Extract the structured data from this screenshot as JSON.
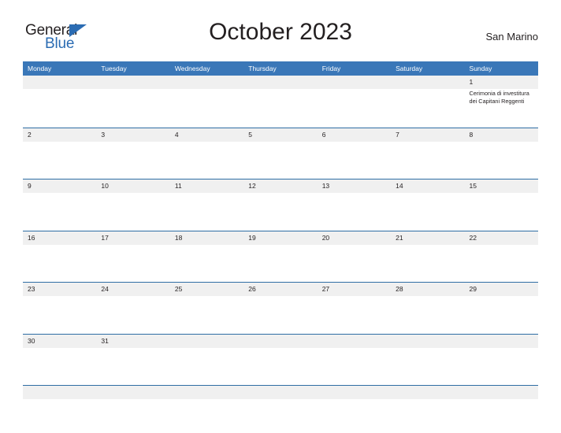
{
  "brand": {
    "name_part1": "General",
    "name_part2": "Blue",
    "flag_icon": "triangle-flag-icon",
    "color_primary": "#2b6cb3",
    "color_dark": "#231f20"
  },
  "header": {
    "title": "October 2023",
    "country": "San Marino"
  },
  "calendar": {
    "header_bg": "#3a77b8",
    "rule_color": "#2e6da4",
    "band_bg": "#f0f0f0",
    "weekdays": [
      "Monday",
      "Tuesday",
      "Wednesday",
      "Thursday",
      "Friday",
      "Saturday",
      "Sunday"
    ],
    "weeks": [
      [
        {
          "date": "",
          "events": []
        },
        {
          "date": "",
          "events": []
        },
        {
          "date": "",
          "events": []
        },
        {
          "date": "",
          "events": []
        },
        {
          "date": "",
          "events": []
        },
        {
          "date": "",
          "events": []
        },
        {
          "date": "1",
          "events": [
            "Cerimonia di investitura dei Capitani Reggenti"
          ]
        }
      ],
      [
        {
          "date": "2",
          "events": []
        },
        {
          "date": "3",
          "events": []
        },
        {
          "date": "4",
          "events": []
        },
        {
          "date": "5",
          "events": []
        },
        {
          "date": "6",
          "events": []
        },
        {
          "date": "7",
          "events": []
        },
        {
          "date": "8",
          "events": []
        }
      ],
      [
        {
          "date": "9",
          "events": []
        },
        {
          "date": "10",
          "events": []
        },
        {
          "date": "11",
          "events": []
        },
        {
          "date": "12",
          "events": []
        },
        {
          "date": "13",
          "events": []
        },
        {
          "date": "14",
          "events": []
        },
        {
          "date": "15",
          "events": []
        }
      ],
      [
        {
          "date": "16",
          "events": []
        },
        {
          "date": "17",
          "events": []
        },
        {
          "date": "18",
          "events": []
        },
        {
          "date": "19",
          "events": []
        },
        {
          "date": "20",
          "events": []
        },
        {
          "date": "21",
          "events": []
        },
        {
          "date": "22",
          "events": []
        }
      ],
      [
        {
          "date": "23",
          "events": []
        },
        {
          "date": "24",
          "events": []
        },
        {
          "date": "25",
          "events": []
        },
        {
          "date": "26",
          "events": []
        },
        {
          "date": "27",
          "events": []
        },
        {
          "date": "28",
          "events": []
        },
        {
          "date": "29",
          "events": []
        }
      ],
      [
        {
          "date": "30",
          "events": []
        },
        {
          "date": "31",
          "events": []
        },
        {
          "date": "",
          "events": []
        },
        {
          "date": "",
          "events": []
        },
        {
          "date": "",
          "events": []
        },
        {
          "date": "",
          "events": []
        },
        {
          "date": "",
          "events": []
        }
      ]
    ]
  }
}
